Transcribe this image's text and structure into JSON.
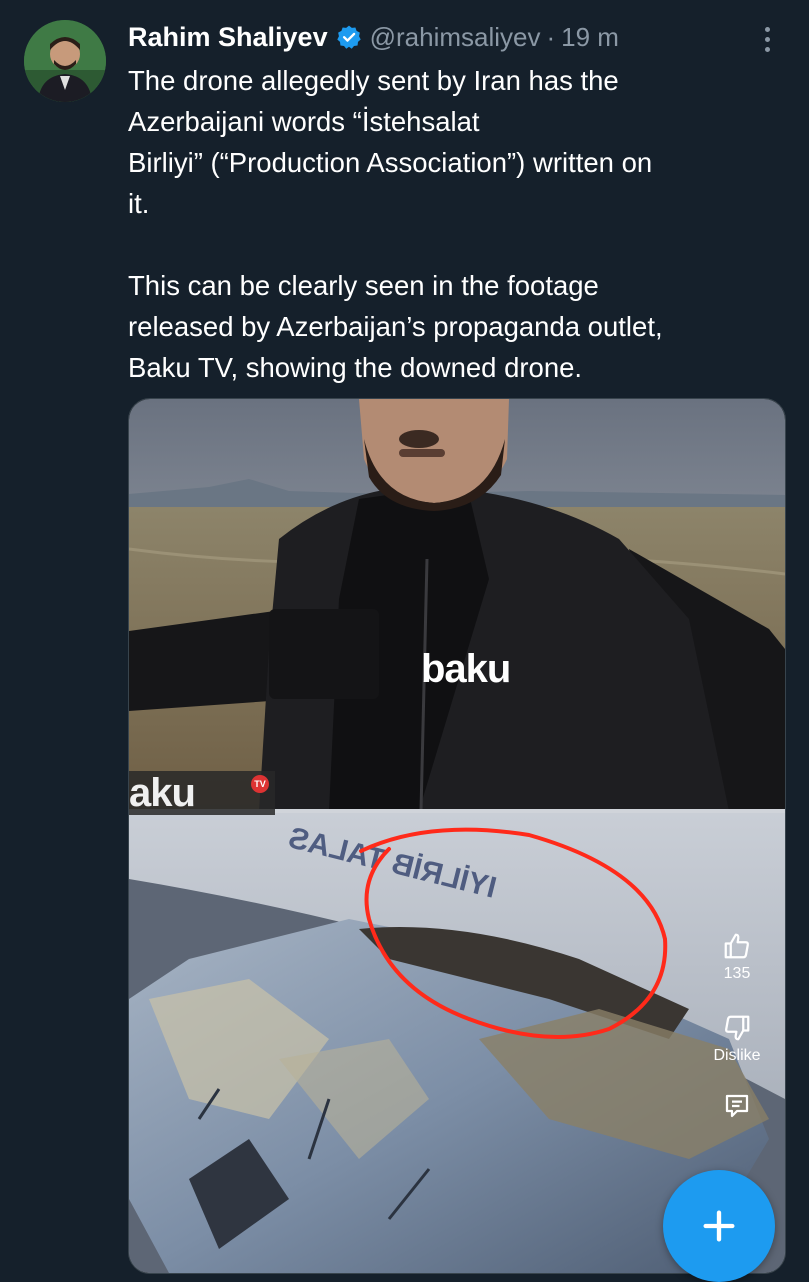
{
  "tweet": {
    "author_name": "Rahim Shaliyev",
    "handle": "@rahimsaliyev",
    "separator": "·",
    "time": "19 m",
    "paragraph_1": "The drone allegedly sent by Iran has the\nAzerbaijani words “İstehsalat\nBirliyi” (“Production Association”) written on\nit.",
    "paragraph_2": "This can be clearly seen in the footage\nreleased by Azerbaijan’s propaganda outlet,\nBaku TV, showing the downed drone."
  },
  "media": {
    "vest_logo": "baku",
    "watermark": "aku",
    "watermark_badge": "TV",
    "drone_marking_text": "IYİLRİB TALAS",
    "actions": {
      "like_count": "135",
      "dislike_label": "Dislike"
    }
  },
  "colors": {
    "background": "#15202b",
    "accent": "#1d9bf0",
    "secondary_text": "#8b98a5",
    "annotation_circle": "#ff2a1a"
  },
  "icons": {
    "verified": "verified-badge-icon",
    "more": "more-options-icon",
    "like": "thumbs-up-icon",
    "dislike": "thumbs-down-icon",
    "comment": "comment-icon",
    "compose": "plus-icon"
  }
}
